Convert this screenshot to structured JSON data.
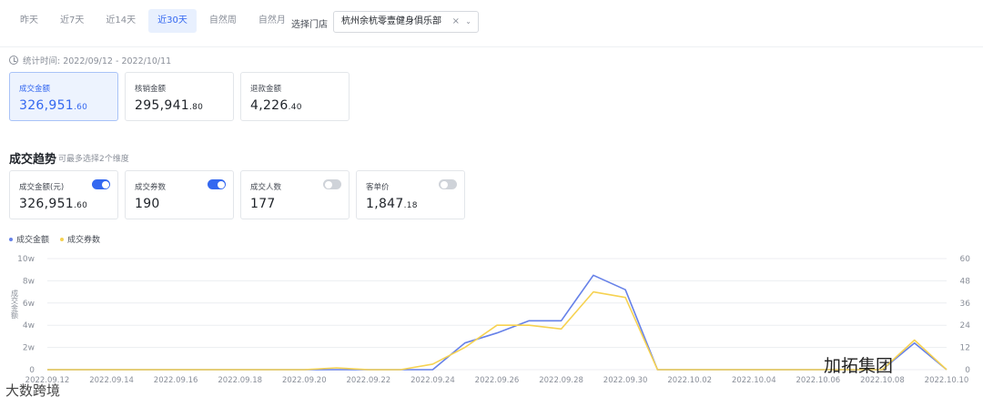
{
  "tabs": [
    {
      "label": "昨天"
    },
    {
      "label": "近7天"
    },
    {
      "label": "近14天"
    },
    {
      "label": "近30天",
      "active": true
    },
    {
      "label": "自然周"
    },
    {
      "label": "自然月"
    }
  ],
  "store": {
    "label": "选择门店",
    "value": "杭州余杭零壹健身俱乐部",
    "clear": "×",
    "chevron": "⌄"
  },
  "stat_time": "统计时间: 2022/09/12 - 2022/10/11",
  "summary_cards": [
    {
      "label": "成交金额",
      "value_main": "326,951",
      "value_dec": ".60",
      "active": true
    },
    {
      "label": "核销金额",
      "value_main": "295,941",
      "value_dec": ".80"
    },
    {
      "label": "退款金额",
      "value_main": "4,226",
      "value_dec": ".40"
    }
  ],
  "trend": {
    "title": "成交趋势",
    "subtitle": "可最多选择2个维度"
  },
  "metric_cards": [
    {
      "label": "成交金额(元)",
      "value_main": "326,951",
      "value_dec": ".60",
      "toggle": "on"
    },
    {
      "label": "成交券数",
      "value_main": "190",
      "value_dec": "",
      "toggle": "on"
    },
    {
      "label": "成交人数",
      "value_main": "177",
      "value_dec": "",
      "toggle": "off"
    },
    {
      "label": "客单价",
      "value_main": "1,847",
      "value_dec": ".18",
      "toggle": "off"
    }
  ],
  "legend": [
    {
      "name": "成交金额",
      "color": "#6681e8"
    },
    {
      "name": "成交券数",
      "color": "#f6d251"
    }
  ],
  "watermarks": {
    "left": "大数跨境",
    "right": "加拓集团"
  },
  "chart_data": {
    "type": "line",
    "ylabel": "成交金额",
    "x": [
      "2022.09.12",
      "2022.09.13",
      "2022.09.14",
      "2022.09.15",
      "2022.09.16",
      "2022.09.17",
      "2022.09.18",
      "2022.09.19",
      "2022.09.20",
      "2022.09.21",
      "2022.09.22",
      "2022.09.23",
      "2022.09.24",
      "2022.09.25",
      "2022.09.26",
      "2022.09.27",
      "2022.09.28",
      "2022.09.29",
      "2022.09.30",
      "2022.10.01",
      "2022.10.02",
      "2022.10.03",
      "2022.10.04",
      "2022.10.05",
      "2022.10.06",
      "2022.10.07",
      "2022.10.08",
      "2022.10.09",
      "2022.10.10"
    ],
    "x_tick_labels": [
      "2022.09.12",
      "2022.09.14",
      "2022.09.16",
      "2022.09.18",
      "2022.09.20",
      "2022.09.22",
      "2022.09.24",
      "2022.09.26",
      "2022.09.28",
      "2022.09.30",
      "2022.10.02",
      "2022.10.04",
      "2022.10.06",
      "2022.10.08",
      "2022.10.10"
    ],
    "y_left_ticks": [
      "0",
      "2w",
      "4w",
      "6w",
      "8w",
      "10w"
    ],
    "y_right_ticks": [
      "0",
      "12",
      "24",
      "36",
      "48",
      "60"
    ],
    "ylim_left": [
      0,
      100000
    ],
    "ylim_right": [
      0,
      60
    ],
    "series": [
      {
        "name": "成交金额",
        "axis": "left",
        "color": "#6681e8",
        "values": [
          0,
          0,
          0,
          0,
          0,
          0,
          0,
          0,
          0,
          0,
          0,
          0,
          0,
          24000,
          33000,
          44000,
          44000,
          85000,
          72000,
          0,
          0,
          0,
          0,
          0,
          0,
          0,
          0,
          24000,
          0
        ]
      },
      {
        "name": "成交券数",
        "axis": "right",
        "color": "#f6d251",
        "values": [
          0,
          0,
          0,
          0,
          0,
          0,
          0,
          0,
          0,
          1,
          0,
          0,
          3,
          12,
          24,
          24,
          22,
          42,
          39,
          0,
          0,
          0,
          0,
          0,
          0,
          0,
          0,
          16,
          0
        ]
      }
    ]
  }
}
